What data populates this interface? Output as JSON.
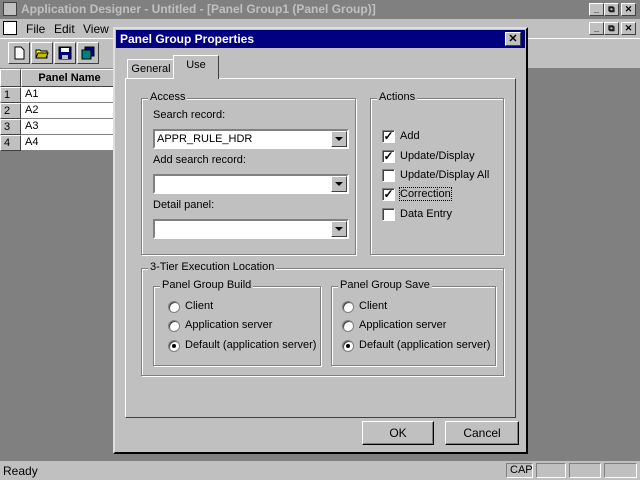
{
  "window": {
    "title": "Application Designer - Untitled - [Panel Group1 (Panel Group)]",
    "controls": [
      "_",
      "⧉",
      "✕"
    ]
  },
  "menubar": {
    "items": [
      "File",
      "Edit",
      "View"
    ],
    "mdi_controls": [
      "_",
      "⧉",
      "✕"
    ]
  },
  "toolbar": {
    "buttons": [
      "new-icon",
      "open-icon",
      "save-icon",
      "save-all-icon"
    ]
  },
  "grid": {
    "column_header": "Panel Name",
    "rows": [
      {
        "num": "1",
        "name": "A1"
      },
      {
        "num": "2",
        "name": "A2"
      },
      {
        "num": "3",
        "name": "A3"
      },
      {
        "num": "4",
        "name": "A4"
      }
    ]
  },
  "dialog": {
    "title": "Panel Group Properties",
    "close": "✕",
    "tabs": [
      {
        "label": "General",
        "active": false
      },
      {
        "label": "Use",
        "active": true
      }
    ],
    "access": {
      "legend": "Access",
      "search_record_label": "Search record:",
      "search_record_value": "APPR_RULE_HDR",
      "add_search_record_label": "Add search record:",
      "add_search_record_value": "",
      "detail_panel_label": "Detail panel:",
      "detail_panel_value": ""
    },
    "actions": {
      "legend": "Actions",
      "items": [
        {
          "label": "Add",
          "checked": true
        },
        {
          "label": "Update/Display",
          "checked": true
        },
        {
          "label": "Update/Display All",
          "checked": false
        },
        {
          "label": "Correction",
          "checked": true
        },
        {
          "label": "Data Entry",
          "checked": false
        }
      ]
    },
    "tier": {
      "legend": "3-Tier Execution Location",
      "build": {
        "legend": "Panel Group Build",
        "options": [
          {
            "label": "Client",
            "selected": false
          },
          {
            "label": "Application server",
            "selected": false
          },
          {
            "label": "Default (application server)",
            "selected": true
          }
        ]
      },
      "save": {
        "legend": "Panel Group Save",
        "options": [
          {
            "label": "Client",
            "selected": false
          },
          {
            "label": "Application server",
            "selected": false
          },
          {
            "label": "Default (application server)",
            "selected": true
          }
        ]
      }
    },
    "ok_label": "OK",
    "cancel_label": "Cancel"
  },
  "statusbar": {
    "text": "Ready",
    "panels": [
      "CAP",
      "",
      "",
      ""
    ]
  },
  "colors": {
    "titlebar_active": "#000080",
    "titlebar_inactive": "#808080",
    "face": "#c0c0c0",
    "workspace": "#808080"
  }
}
